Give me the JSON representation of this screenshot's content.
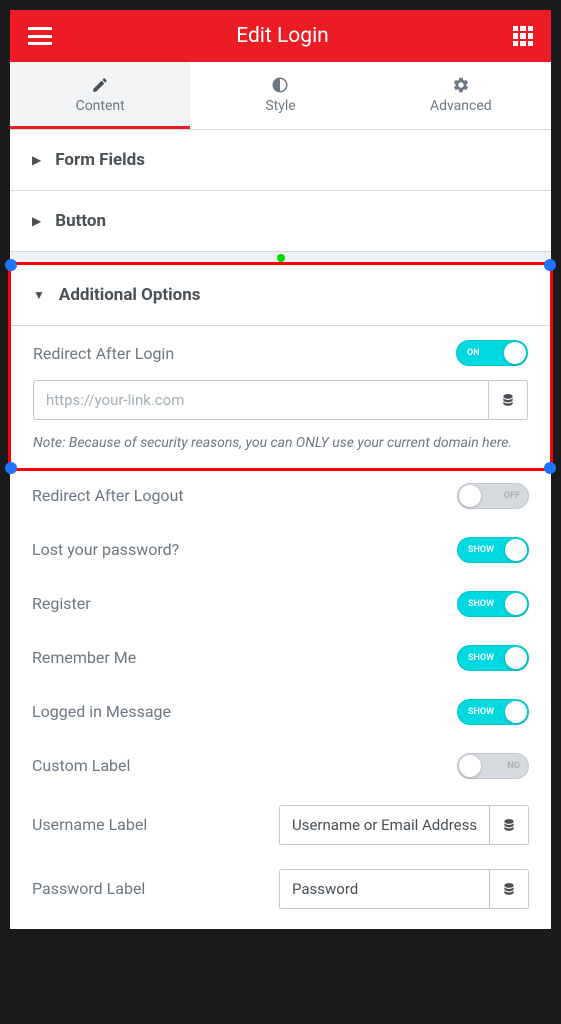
{
  "header": {
    "title": "Edit Login"
  },
  "tabs": [
    {
      "label": "Content",
      "active": true
    },
    {
      "label": "Style",
      "active": false
    },
    {
      "label": "Advanced",
      "active": false
    }
  ],
  "sections": {
    "form_fields": {
      "title": "Form Fields",
      "expanded": false
    },
    "button": {
      "title": "Button",
      "expanded": false
    },
    "additional": {
      "title": "Additional Options",
      "expanded": true
    }
  },
  "options": {
    "redirect_login": {
      "label": "Redirect After Login",
      "state": "ON",
      "on": true
    },
    "url": {
      "placeholder": "https://your-link.com"
    },
    "note": "Note: Because of security reasons, you can ONLY use your current domain here.",
    "redirect_logout": {
      "label": "Redirect After Logout",
      "state": "OFF",
      "on": false
    },
    "lost_password": {
      "label": "Lost your password?",
      "state": "SHOW",
      "on": true
    },
    "register": {
      "label": "Register",
      "state": "SHOW",
      "on": true
    },
    "remember_me": {
      "label": "Remember Me",
      "state": "SHOW",
      "on": true
    },
    "logged_in": {
      "label": "Logged in Message",
      "state": "SHOW",
      "on": true
    },
    "custom_label": {
      "label": "Custom Label",
      "state": "NO",
      "on": false
    },
    "username_label": {
      "label": "Username Label",
      "value": "Username or Email Address"
    },
    "password_label": {
      "label": "Password Label",
      "value": "Password"
    }
  }
}
